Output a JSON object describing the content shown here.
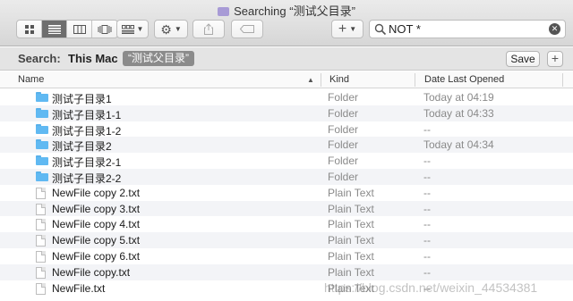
{
  "window": {
    "title": "Searching “测试父目录”"
  },
  "toolbar": {
    "view_icon": "icon-view-icon",
    "list_view_icon": "list-view-icon",
    "column_view_icon": "column-view-icon",
    "coverflow_icon": "coverflow-view-icon",
    "group_icon": "group-by-icon",
    "action_icon": "gear-icon",
    "share_icon": "share-icon",
    "tag_icon": "tag-icon",
    "add_icon": "plus-icon"
  },
  "search": {
    "value": "NOT *",
    "placeholder": ""
  },
  "searchbar": {
    "label": "Search:",
    "scope": "This Mac",
    "token": "“测试父目录”",
    "save_label": "Save",
    "add_label": "+"
  },
  "columns": {
    "name": "Name",
    "kind": "Kind",
    "date": "Date Last Opened"
  },
  "rows": [
    {
      "icon": "folder",
      "name": "测试子目录1",
      "kind": "Folder",
      "date": "Today at 04:19"
    },
    {
      "icon": "folder",
      "name": "测试子目录1-1",
      "kind": "Folder",
      "date": "Today at 04:33"
    },
    {
      "icon": "folder",
      "name": "测试子目录1-2",
      "kind": "Folder",
      "date": "--"
    },
    {
      "icon": "folder",
      "name": "测试子目录2",
      "kind": "Folder",
      "date": "Today at 04:34"
    },
    {
      "icon": "folder",
      "name": "测试子目录2-1",
      "kind": "Folder",
      "date": "--"
    },
    {
      "icon": "folder",
      "name": "测试子目录2-2",
      "kind": "Folder",
      "date": "--"
    },
    {
      "icon": "file",
      "name": "NewFile copy 2.txt",
      "kind": "Plain Text",
      "date": "--"
    },
    {
      "icon": "file",
      "name": "NewFile copy 3.txt",
      "kind": "Plain Text",
      "date": "--"
    },
    {
      "icon": "file",
      "name": "NewFile copy 4.txt",
      "kind": "Plain Text",
      "date": "--"
    },
    {
      "icon": "file",
      "name": "NewFile copy 5.txt",
      "kind": "Plain Text",
      "date": "--"
    },
    {
      "icon": "file",
      "name": "NewFile copy 6.txt",
      "kind": "Plain Text",
      "date": "--"
    },
    {
      "icon": "file",
      "name": "NewFile copy.txt",
      "kind": "Plain Text",
      "date": "--"
    },
    {
      "icon": "file",
      "name": "NewFile.txt",
      "kind": "Plain Text",
      "date": "--"
    }
  ],
  "watermark": "https://blog.csdn.net/weixin_44534381",
  "colors": {
    "accent_folder": "#60b9f2",
    "active_segment": "#6e6e6e",
    "token_bg": "#8b8b8b"
  }
}
